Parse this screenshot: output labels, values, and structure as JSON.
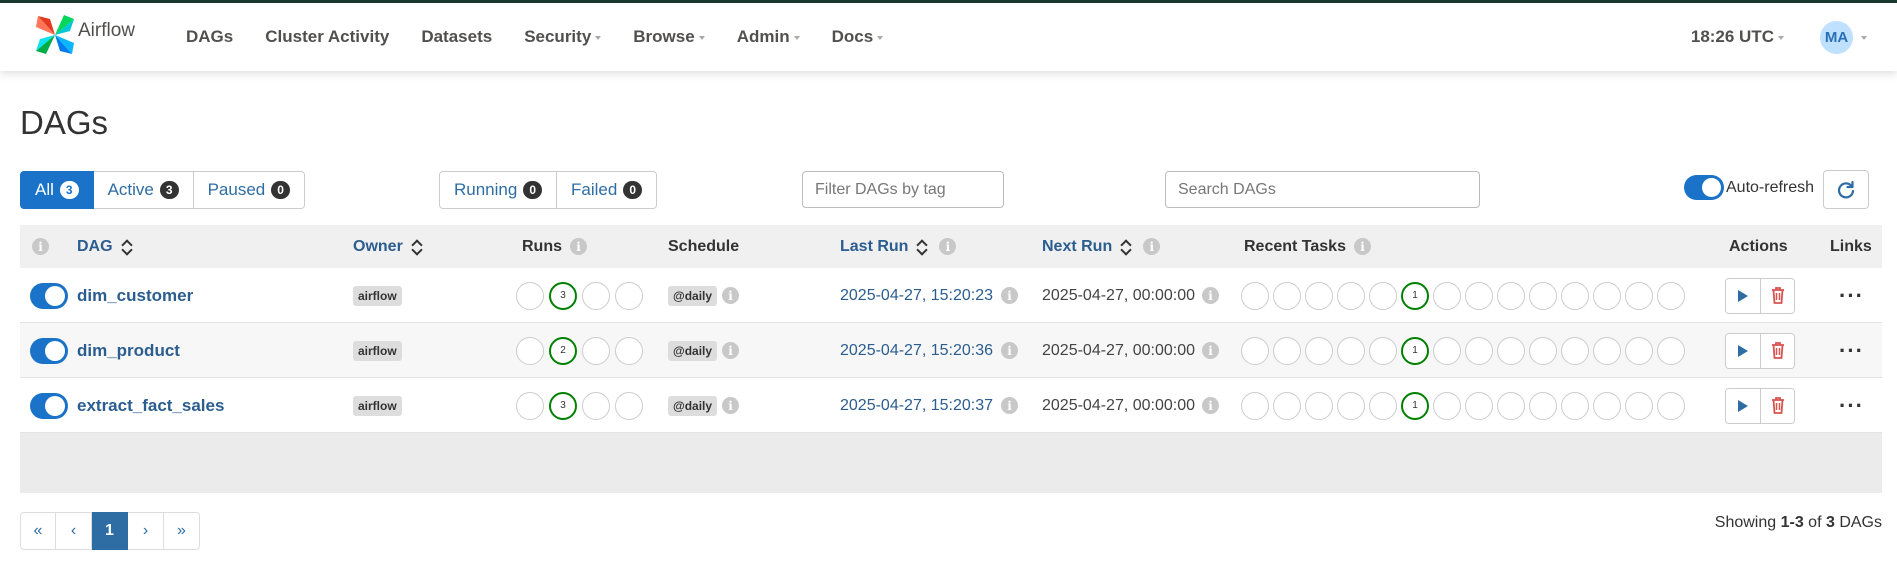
{
  "navbar": {
    "brand": "Airflow",
    "items": [
      {
        "label": "DAGs",
        "dropdown": false
      },
      {
        "label": "Cluster Activity",
        "dropdown": false
      },
      {
        "label": "Datasets",
        "dropdown": false
      },
      {
        "label": "Security",
        "dropdown": true
      },
      {
        "label": "Browse",
        "dropdown": true
      },
      {
        "label": "Admin",
        "dropdown": true
      },
      {
        "label": "Docs",
        "dropdown": true
      }
    ],
    "clock": "18:26 UTC",
    "avatar": "MA"
  },
  "page_title": "DAGs",
  "status_filters": [
    {
      "label": "All",
      "count": "3",
      "active": true
    },
    {
      "label": "Active",
      "count": "3",
      "active": false
    },
    {
      "label": "Paused",
      "count": "0",
      "active": false
    }
  ],
  "run_filters": [
    {
      "label": "Running",
      "count": "0"
    },
    {
      "label": "Failed",
      "count": "0"
    }
  ],
  "tag_filter": {
    "placeholder": "Filter DAGs by tag"
  },
  "search": {
    "placeholder": "Search DAGs"
  },
  "auto_refresh": {
    "label": "Auto-refresh",
    "enabled": true
  },
  "table": {
    "headers": {
      "dag": "DAG",
      "owner": "Owner",
      "runs": "Runs",
      "schedule": "Schedule",
      "last_run": "Last Run",
      "next_run": "Next Run",
      "recent_tasks": "Recent Tasks",
      "actions": "Actions",
      "links": "Links"
    },
    "rows": [
      {
        "dag_id": "dim_customer",
        "owner": "airflow",
        "runs": [
          "",
          "3",
          "",
          ""
        ],
        "schedule": "@daily",
        "last_run": "2025-04-27, 15:20:23",
        "next_run": "2025-04-27, 00:00:00",
        "recent_tasks": [
          "",
          "",
          "",
          "",
          "",
          "1",
          "",
          "",
          "",
          "",
          "",
          "",
          "",
          ""
        ],
        "paused": false
      },
      {
        "dag_id": "dim_product",
        "owner": "airflow",
        "runs": [
          "",
          "2",
          "",
          ""
        ],
        "schedule": "@daily",
        "last_run": "2025-04-27, 15:20:36",
        "next_run": "2025-04-27, 00:00:00",
        "recent_tasks": [
          "",
          "",
          "",
          "",
          "",
          "1",
          "",
          "",
          "",
          "",
          "",
          "",
          "",
          ""
        ],
        "paused": false
      },
      {
        "dag_id": "extract_fact_sales",
        "owner": "airflow",
        "runs": [
          "",
          "3",
          "",
          ""
        ],
        "schedule": "@daily",
        "last_run": "2025-04-27, 15:20:37",
        "next_run": "2025-04-27, 00:00:00",
        "recent_tasks": [
          "",
          "",
          "",
          "",
          "",
          "1",
          "",
          "",
          "",
          "",
          "",
          "",
          "",
          ""
        ],
        "paused": false
      }
    ]
  },
  "pagination": {
    "first": "«",
    "prev": "‹",
    "current": "1",
    "next": "›",
    "last": "»"
  },
  "footer": {
    "prefix": "Showing ",
    "range": "1-3",
    "of": " of ",
    "total": "3",
    "suffix": " DAGs"
  },
  "colors": {
    "accent": "#1a73c8",
    "link": "#2b5d8f",
    "success": "#008000",
    "danger": "#d9534f"
  }
}
